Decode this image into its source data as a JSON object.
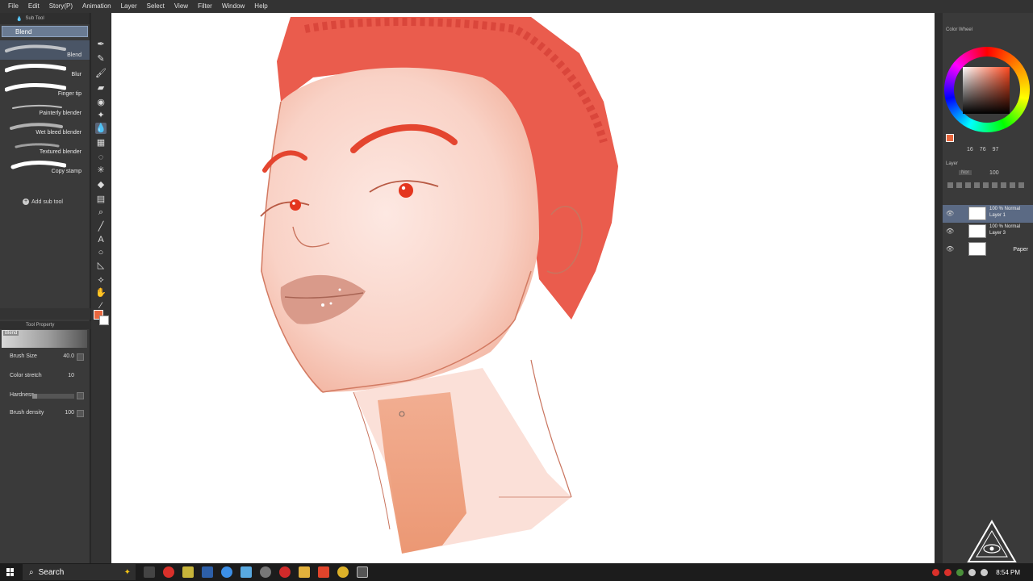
{
  "menu": [
    "File",
    "Edit",
    "Story(P)",
    "Animation",
    "Layer",
    "Select",
    "View",
    "Filter",
    "Window",
    "Help"
  ],
  "subtool": {
    "header": "Sub Tool",
    "tab": "Blend",
    "brushes": [
      "Blend",
      "Blur",
      "Finger tip",
      "Painterly blender",
      "Wet bleed blender",
      "Textured blender",
      "Copy stamp"
    ],
    "add_label": "Add sub tool"
  },
  "tool_property": {
    "header": "Tool Property",
    "preview_label": "Blend",
    "brush_size_label": "Brush Size",
    "brush_size_value": "40.0",
    "color_stretch_label": "Color stretch",
    "color_stretch_value": "10",
    "hardness_label": "Hardness",
    "brush_density_label": "Brush density",
    "brush_density_value": "100"
  },
  "color_wheel": {
    "header": "Color Wheel",
    "values": [
      "16",
      "76",
      "97"
    ],
    "current_color": "#e9673e"
  },
  "layers": {
    "header": "Layer",
    "blend_mode": "Nor",
    "opacity": "100",
    "items": [
      {
        "l1": "100 % Normal",
        "l2": "Layer 1"
      },
      {
        "l1": "100 % Normal",
        "l2": "Layer 3"
      },
      {
        "paper": "Paper"
      }
    ]
  },
  "taskbar": {
    "search": "Search",
    "time": "8:54 PM"
  }
}
